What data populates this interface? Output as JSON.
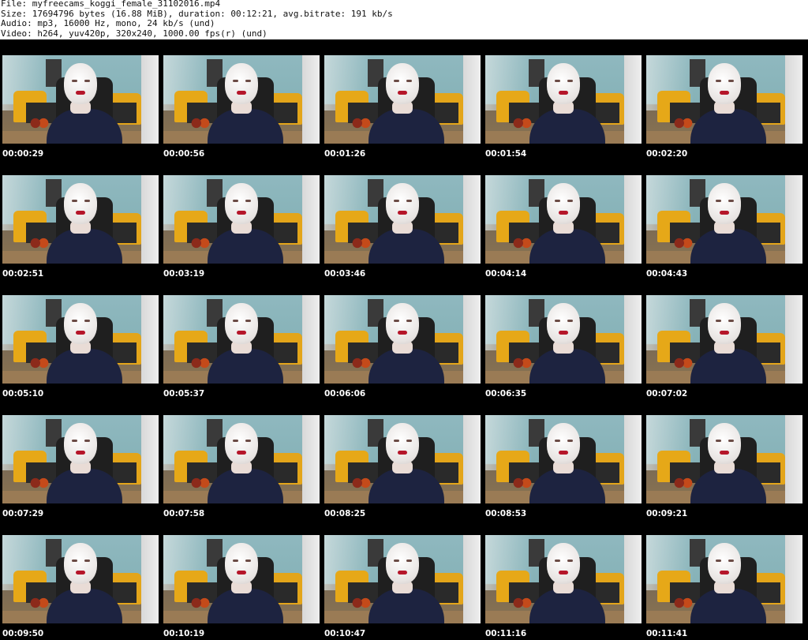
{
  "header": {
    "file": "File: myfreecams_koggi_female_31102016.mp4",
    "size": "Size: 17694796 bytes (16.88 MiB), duration: 00:12:21, avg.bitrate: 191 kb/s",
    "audio": "Audio: mp3, 16000 Hz, mono, 24 kb/s (und)",
    "video": "Video: h264, yuv420p, 320x240, 1000.00 fps(r) (und)"
  },
  "thumbnails": [
    {
      "time": "00:00:29"
    },
    {
      "time": "00:00:56"
    },
    {
      "time": "00:01:26"
    },
    {
      "time": "00:01:54"
    },
    {
      "time": "00:02:20"
    },
    {
      "time": "00:02:51"
    },
    {
      "time": "00:03:19"
    },
    {
      "time": "00:03:46"
    },
    {
      "time": "00:04:14"
    },
    {
      "time": "00:04:43"
    },
    {
      "time": "00:05:10"
    },
    {
      "time": "00:05:37"
    },
    {
      "time": "00:06:06"
    },
    {
      "time": "00:06:35"
    },
    {
      "time": "00:07:02"
    },
    {
      "time": "00:07:29"
    },
    {
      "time": "00:07:58"
    },
    {
      "time": "00:08:25"
    },
    {
      "time": "00:08:53"
    },
    {
      "time": "00:09:21"
    },
    {
      "time": "00:09:50"
    },
    {
      "time": "00:10:19"
    },
    {
      "time": "00:10:47"
    },
    {
      "time": "00:11:16"
    },
    {
      "time": "00:11:41"
    }
  ],
  "colors": {
    "background": "#000000",
    "header_background": "#ffffff",
    "timestamp": "#ffffff"
  }
}
